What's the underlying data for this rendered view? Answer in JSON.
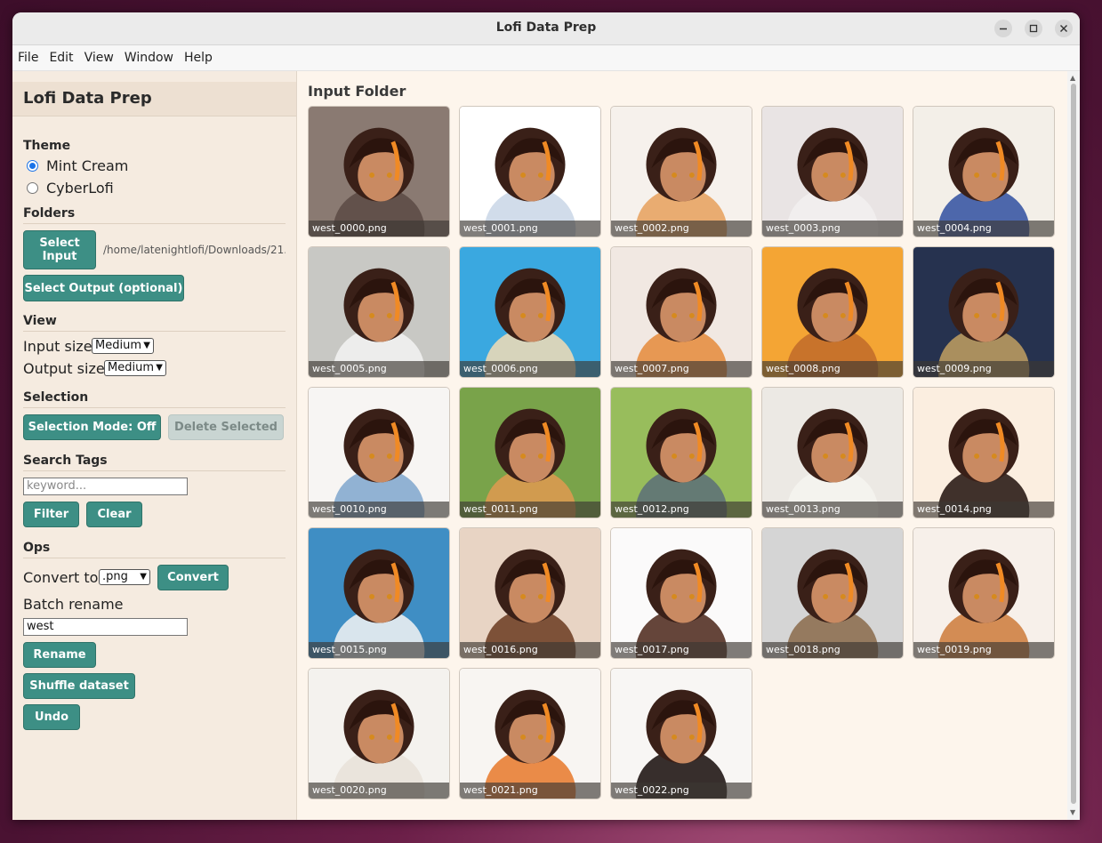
{
  "window": {
    "title": "Lofi Data Prep"
  },
  "menu": [
    "File",
    "Edit",
    "View",
    "Window",
    "Help"
  ],
  "sidebar": {
    "title": "Lofi Data Prep",
    "theme": {
      "heading": "Theme",
      "options": [
        {
          "label": "Mint Cream",
          "selected": true
        },
        {
          "label": "CyberLofi",
          "selected": false
        }
      ]
    },
    "folders": {
      "heading": "Folders",
      "select_input_label": "Select Input",
      "input_path": "/home/latenightlofi/Downloads/21...",
      "select_output_label": "Select Output (optional)"
    },
    "view": {
      "heading": "View",
      "input_size_label": "Input size",
      "input_size_value": "Medium",
      "output_size_label": "Output size",
      "output_size_value": "Medium"
    },
    "selection": {
      "heading": "Selection",
      "mode_label": "Selection Mode: Off",
      "delete_label": "Delete Selected"
    },
    "search": {
      "heading": "Search Tags",
      "placeholder": "keyword...",
      "filter_label": "Filter",
      "clear_label": "Clear"
    },
    "ops": {
      "heading": "Ops",
      "convert_to_label": "Convert to",
      "format_value": ".png",
      "convert_label": "Convert",
      "batch_rename_label": "Batch rename",
      "rename_value": "west",
      "rename_label": "Rename",
      "shuffle_label": "Shuffle dataset",
      "undo_label": "Undo"
    }
  },
  "main": {
    "heading": "Input Folder",
    "images": [
      {
        "name": "west_0000.png",
        "bg": "#8a7a72",
        "accent": "#5b4a44"
      },
      {
        "name": "west_0001.png",
        "bg": "#ffffff",
        "accent": "#c9d6e6"
      },
      {
        "name": "west_0002.png",
        "bg": "#f6f1ec",
        "accent": "#e6a05c"
      },
      {
        "name": "west_0003.png",
        "bg": "#e9e4e4",
        "accent": "#f2f0f0"
      },
      {
        "name": "west_0004.png",
        "bg": "#f3efe8",
        "accent": "#2f4fa0"
      },
      {
        "name": "west_0005.png",
        "bg": "#c8c8c4",
        "accent": "#f3f3f3"
      },
      {
        "name": "west_0006.png",
        "bg": "#3aa8e0",
        "accent": "#f3dcb4"
      },
      {
        "name": "west_0007.png",
        "bg": "#f1e8e2",
        "accent": "#e58a3a"
      },
      {
        "name": "west_0008.png",
        "bg": "#f4a534",
        "accent": "#c06a2a"
      },
      {
        "name": "west_0009.png",
        "bg": "#26324f",
        "accent": "#c2a060"
      },
      {
        "name": "west_0010.png",
        "bg": "#f7f5f3",
        "accent": "#7fa6cc"
      },
      {
        "name": "west_0011.png",
        "bg": "#79a34a",
        "accent": "#e09a50"
      },
      {
        "name": "west_0012.png",
        "bg": "#98bd5c",
        "accent": "#5a6e78"
      },
      {
        "name": "west_0013.png",
        "bg": "#ece9e4",
        "accent": "#f6f4f0"
      },
      {
        "name": "west_0014.png",
        "bg": "#fbeee0",
        "accent": "#1e0f0a"
      },
      {
        "name": "west_0015.png",
        "bg": "#3f8ec4",
        "accent": "#f5f5f5"
      },
      {
        "name": "west_0016.png",
        "bg": "#e8d4c4",
        "accent": "#6a3a20"
      },
      {
        "name": "west_0017.png",
        "bg": "#fbfafa",
        "accent": "#4a2418"
      },
      {
        "name": "west_0018.png",
        "bg": "#d5d5d5",
        "accent": "#8a6a4a"
      },
      {
        "name": "west_0019.png",
        "bg": "#f7f0ea",
        "accent": "#cc7a3a"
      },
      {
        "name": "west_0020.png",
        "bg": "#f4f2ee",
        "accent": "#e8e2d8"
      },
      {
        "name": "west_0021.png",
        "bg": "#f8f5f2",
        "accent": "#e8782a"
      },
      {
        "name": "west_0022.png",
        "bg": "#f8f6f4",
        "accent": "#150a08"
      }
    ]
  }
}
